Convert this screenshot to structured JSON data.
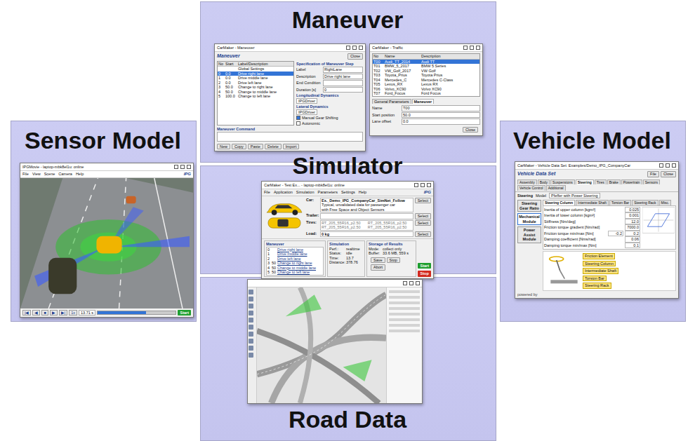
{
  "maneuver": {
    "label": "Maneuver",
    "window": {
      "title": "CarMaker - Maneuver",
      "header": "Maneuver",
      "close": "Close",
      "columns": [
        "No",
        "Start",
        "Label/Description"
      ],
      "rows": [
        {
          "cells": [
            "",
            "",
            "Global Settings"
          ],
          "selected": false
        },
        {
          "cells": [
            "0",
            "0.0",
            "Drive right lane"
          ],
          "selected": true
        },
        {
          "cells": [
            "1",
            "0.0",
            "Drive middle lane"
          ],
          "selected": false
        },
        {
          "cells": [
            "2",
            "0.0",
            "Drive left lane"
          ],
          "selected": false
        },
        {
          "cells": [
            "3",
            "50.0",
            "Change to right lane"
          ],
          "selected": false
        },
        {
          "cells": [
            "4",
            "50.0",
            "Change to middle lane"
          ],
          "selected": false
        },
        {
          "cells": [
            "5",
            "100.0",
            "Change to left lane"
          ],
          "selected": false
        }
      ],
      "spec_title": "Specification of Maneuver Step",
      "fields": [
        {
          "label": "Label",
          "value": "RightLane"
        },
        {
          "label": "Description",
          "value": "Drive right lane"
        },
        {
          "label": "End Condition",
          "value": ""
        },
        {
          "label": "Duration [s]",
          "value": "0"
        }
      ],
      "long_title": "Longitudinal Dynamics",
      "long_value": "IPGDriver",
      "lat_title": "Lateral Dynamics",
      "lat_value": "IPGDriver",
      "checks": [
        {
          "label": "Manual Gear Shifting",
          "checked": true
        },
        {
          "label": "Autonomic",
          "checked": false
        }
      ],
      "command_title": "Maneuver Command",
      "buttons": [
        "New",
        "Copy",
        "Paste",
        "Delete",
        "Import"
      ]
    }
  },
  "traffic": {
    "window": {
      "title": "CarMaker - Traffic",
      "columns": [
        "No",
        "Name",
        "Description"
      ],
      "rows": [
        {
          "cells": [
            "T00",
            "Audi_TT_2014",
            "Audi TT"
          ],
          "selected": true
        },
        {
          "cells": [
            "T01",
            "BMW_5_2017",
            "BMW 5 Series"
          ],
          "selected": false
        },
        {
          "cells": [
            "T02",
            "VW_Golf_2017",
            "VW Golf"
          ],
          "selected": false
        },
        {
          "cells": [
            "T03",
            "Toyota_Prius",
            "Toyota Prius"
          ],
          "selected": false
        },
        {
          "cells": [
            "T04",
            "Mercedes_C",
            "Mercedes C-Class"
          ],
          "selected": false
        },
        {
          "cells": [
            "T05",
            "Lexus_RX",
            "Lexus RX"
          ],
          "selected": false
        },
        {
          "cells": [
            "T06",
            "Volvo_XC90",
            "Volvo XC90"
          ],
          "selected": false
        },
        {
          "cells": [
            "T07",
            "Ford_Focus",
            "Ford Focus"
          ],
          "selected": false
        }
      ],
      "tabs": [
        {
          "label": "General Parameters",
          "selected": false
        },
        {
          "label": "Maneuver",
          "selected": true
        }
      ],
      "fields": [
        {
          "label": "Name",
          "value": "T00"
        },
        {
          "label": "Start position",
          "value": "50.0"
        },
        {
          "label": "Lane offset",
          "value": "0.0"
        }
      ],
      "close": "Close"
    }
  },
  "simulator": {
    "label": "Simulator",
    "window": {
      "title": "CarMaker - Test Ex... - laptop-mbk8el1u: online",
      "menu": [
        "File",
        "Application",
        "Simulation",
        "Parameters",
        "Settings",
        "Help"
      ],
      "logo": "IPG",
      "rows": [
        {
          "label": "Car:",
          "kind": "text",
          "lines": [
            "Ex._Demo_IPG_CompanyCar_SimNet_Follow",
            "Typical, unvalidated data for passenger car",
            "with Free Space and Object Sensors"
          ],
          "button": "Select"
        },
        {
          "label": "Trailer:",
          "kind": "text",
          "lines": [],
          "button": "Select"
        },
        {
          "label": "Tires:",
          "kind": "grid",
          "lines": [
            "RT_205_55R16_p2.50",
            "RT_205_55R16_p2.50",
            "RT_205_55R16_p2.50",
            "RT_205_55R16_p2.50"
          ],
          "button": "Select"
        },
        {
          "label": "Load:",
          "kind": "text",
          "lines": [
            "0 kg"
          ],
          "button": "Select"
        }
      ],
      "maneuver_title": "Maneuver",
      "steps": [
        {
          "no": "0",
          "start": "",
          "label": "Drive right lane"
        },
        {
          "no": "1",
          "start": "",
          "label": "Drive middle lane"
        },
        {
          "no": "2",
          "start": "",
          "label": "Drive left lane"
        },
        {
          "no": "3",
          "start": "50",
          "label": "Change to right lane"
        },
        {
          "no": "4",
          "start": "50",
          "label": "Change to middle lane"
        },
        {
          "no": "5",
          "start": "50",
          "label": "Change to left lane"
        }
      ],
      "simulation_title": "Simulation",
      "sim_fields": [
        {
          "label": "Perf.:",
          "value": "realtime"
        },
        {
          "label": "Status:",
          "value": "idle"
        },
        {
          "label": "Time:",
          "value": "13.7"
        },
        {
          "label": "Distance:",
          "value": "378.76"
        }
      ],
      "storage_title": "Storage of Results",
      "storage_fields": [
        {
          "label": "Mode:",
          "value": "collect only"
        },
        {
          "label": "Buffer:",
          "value": "33.6 MB, 559 s"
        }
      ],
      "storage_buttons": [
        "Save",
        "Stop",
        "Abort"
      ],
      "actions": [
        {
          "label": "Start",
          "kind": "start"
        },
        {
          "label": "Stop",
          "kind": "stop"
        }
      ]
    }
  },
  "sensor": {
    "label": "Sensor Model",
    "window": {
      "title": "IPGMovie - laptop-mbk8el1u: online",
      "menu": [
        "File",
        "View",
        "Scene",
        "Camera",
        "Help"
      ],
      "logo": "IPG",
      "controls": [
        "|◀",
        "◀",
        "■",
        "▶",
        "▶|"
      ],
      "speed": "1x",
      "time": "13.71 s",
      "level": 0.62,
      "start": "Start"
    }
  },
  "vehicle": {
    "label": "Vehicle Model",
    "window": {
      "title": "CarMaker - Vehicle Data Set: Examples/Demo_IPG_CompanyCar",
      "header": "Vehicle Data Set",
      "buttons": [
        "File",
        "Close"
      ],
      "tabs": [
        {
          "label": "Assembly",
          "selected": false
        },
        {
          "label": "Body",
          "selected": false
        },
        {
          "label": "Suspensions",
          "selected": false
        },
        {
          "label": "Steering",
          "selected": true
        },
        {
          "label": "Tires",
          "selected": false
        },
        {
          "label": "Brake",
          "selected": false
        },
        {
          "label": "Powertrain",
          "selected": false
        },
        {
          "label": "Sensors",
          "selected": false
        },
        {
          "label": "Vehicle Control",
          "selected": false
        },
        {
          "label": "Additional",
          "selected": false
        }
      ],
      "section": "Steering",
      "model_label": "Model",
      "model_value": "Pfeffer with Power Steering",
      "modules": [
        {
          "label": "Steering Gear Ratio",
          "selected": false
        },
        {
          "label": "Mechanical Module",
          "selected": true
        },
        {
          "label": "Power Assist Module",
          "selected": false
        }
      ],
      "subtabs": [
        {
          "label": "Steering Column",
          "selected": true
        },
        {
          "label": "Intermediate Shaft",
          "selected": false
        },
        {
          "label": "Torsion Bar",
          "selected": false
        },
        {
          "label": "Steering Rack",
          "selected": false
        },
        {
          "label": "Misc.",
          "selected": false
        }
      ],
      "params": [
        {
          "label": "Inertia of upper column [kgm²]",
          "values": [
            "0.025"
          ]
        },
        {
          "label": "Inertia of lower column [kgm²]",
          "values": [
            "0.001"
          ]
        },
        {
          "label": "Stiffness [Nm/deg]",
          "values": [
            "12.0"
          ]
        },
        {
          "label": "Friction torque gradient [Nm/rad]",
          "values": [
            "7000.0"
          ]
        },
        {
          "label": "Friction torque min/max [Nm]",
          "values": [
            "-0.2",
            "0.2"
          ]
        },
        {
          "label": "Damping coefficient [Nms/rad]",
          "values": [
            "0.06"
          ]
        },
        {
          "label": "Damping torque min/max [Nm]",
          "values": [
            "0.1"
          ]
        }
      ],
      "parts": [
        "Friction Element",
        "Steering Column",
        "Intermediate Shaft",
        "Torsion Bar",
        "Steering Rack"
      ],
      "powered": "powered by"
    }
  },
  "road": {
    "label": "Road Data"
  }
}
